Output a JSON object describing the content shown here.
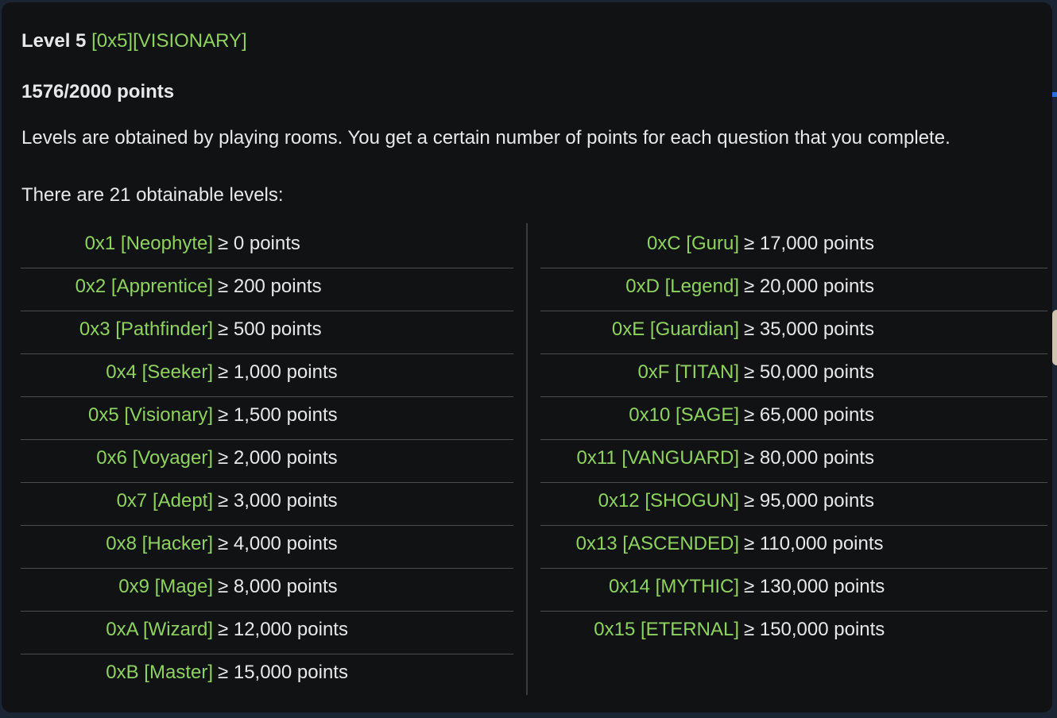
{
  "header": {
    "level_label": "Level 5",
    "level_tag": "[0x5][VISIONARY]",
    "progress_text": "1576/2000 points",
    "progress_current": 1576,
    "progress_total": 2000
  },
  "description": "Levels are obtained by playing rooms. You get a certain number of points for each question that you complete.",
  "levels_count_text": "There are 21 obtainable levels:",
  "colors": {
    "accent": "#8ed35f",
    "panel_bg": "#111214",
    "text": "#e8e8e8"
  },
  "levels_left": [
    {
      "name": "0x1 [Neophyte]",
      "req": "≥ 0 points"
    },
    {
      "name": "0x2 [Apprentice]",
      "req": "≥ 200 points"
    },
    {
      "name": "0x3 [Pathfinder]",
      "req": "≥ 500 points"
    },
    {
      "name": "0x4 [Seeker]",
      "req": "≥ 1,000 points"
    },
    {
      "name": "0x5 [Visionary]",
      "req": "≥ 1,500 points"
    },
    {
      "name": "0x6 [Voyager]",
      "req": "≥ 2,000 points"
    },
    {
      "name": "0x7 [Adept]",
      "req": "≥ 3,000 points"
    },
    {
      "name": "0x8 [Hacker]",
      "req": "≥ 4,000 points"
    },
    {
      "name": "0x9 [Mage]",
      "req": "≥ 8,000 points"
    },
    {
      "name": "0xA [Wizard]",
      "req": "≥ 12,000 points"
    },
    {
      "name": "0xB [Master]",
      "req": "≥ 15,000 points"
    }
  ],
  "levels_right": [
    {
      "name": "0xC [Guru]",
      "req": "≥ 17,000 points"
    },
    {
      "name": "0xD [Legend]",
      "req": "≥ 20,000 points"
    },
    {
      "name": "0xE [Guardian]",
      "req": "≥ 35,000 points"
    },
    {
      "name": "0xF [TITAN]",
      "req": "≥ 50,000 points"
    },
    {
      "name": "0x10 [SAGE]",
      "req": "≥ 65,000 points"
    },
    {
      "name": "0x11 [VANGUARD]",
      "req": "≥ 80,000 points"
    },
    {
      "name": "0x12 [SHOGUN]",
      "req": "≥ 95,000 points"
    },
    {
      "name": "0x13 [ASCENDED]",
      "req": "≥ 110,000 points"
    },
    {
      "name": "0x14 [MYTHIC]",
      "req": "≥ 130,000 points"
    },
    {
      "name": "0x15 [ETERNAL]",
      "req": "≥ 150,000 points"
    }
  ]
}
